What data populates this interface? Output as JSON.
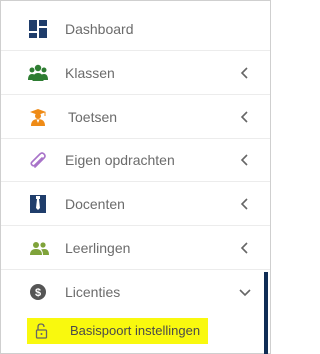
{
  "menu": {
    "items": [
      {
        "label": "Dashboard",
        "icon": "dashboard-icon",
        "color": "#1f3d6b"
      },
      {
        "label": "Klassen",
        "icon": "users-group-icon",
        "color": "#2e7d32"
      },
      {
        "label": "Toetsen",
        "icon": "teacher-icon",
        "color": "#ef8b16"
      },
      {
        "label": "Eigen opdrachten",
        "icon": "paperclip-icon",
        "color": "#a873c9"
      },
      {
        "label": "Docenten",
        "icon": "docent-icon",
        "color": "#1f3d6b"
      },
      {
        "label": "Leerlingen",
        "icon": "users-icon",
        "color": "#7fa33a"
      },
      {
        "label": "Licenties",
        "icon": "dollar-circle-icon",
        "color": "#555555"
      }
    ],
    "subitem": {
      "label": "Basispoort instellingen",
      "icon": "unlock-icon",
      "highlight": "#f9f90e"
    }
  }
}
